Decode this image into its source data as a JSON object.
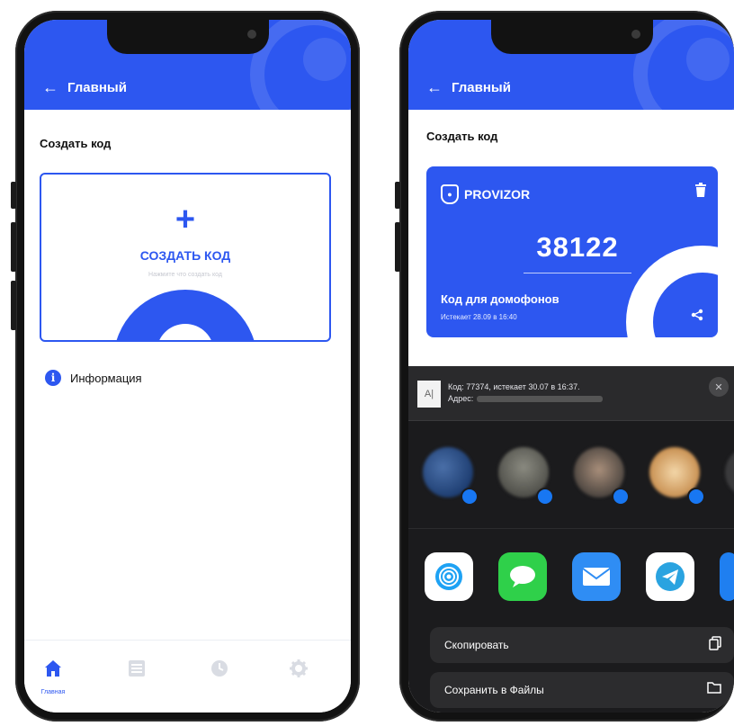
{
  "left": {
    "header": {
      "back_icon": "arrow-left-icon",
      "title": "Главный"
    },
    "section_title": "Создать код",
    "create_card": {
      "plus": "+",
      "label": "СОЗДАТЬ КОД",
      "hint": "Нажмите что создать код"
    },
    "info": {
      "icon": "i",
      "label": "Информация"
    },
    "tabbar": [
      {
        "icon": "home-icon",
        "label": "Главная",
        "active": true
      },
      {
        "icon": "list-icon",
        "label": "",
        "active": false
      },
      {
        "icon": "clock-icon",
        "label": "",
        "active": false
      },
      {
        "icon": "gear-icon",
        "label": "",
        "active": false
      }
    ]
  },
  "right": {
    "header": {
      "back_icon": "arrow-left-icon",
      "title": "Главный"
    },
    "section_title": "Создать код",
    "code_card": {
      "brand": "PROVIZOR",
      "code": "38122",
      "title": "Код для домофонов",
      "expires": "Истекает 28.09 в 16:40"
    },
    "share_sheet": {
      "thumb": "A|",
      "preview_line1": "Код: 77374, истекает 30.07 в 16:37.",
      "preview_line2": "Адрес:",
      "close": "✕",
      "actions": [
        {
          "label": "Скопировать",
          "icon": "copy-icon"
        },
        {
          "label": "Сохранить в Файлы",
          "icon": "folder-icon"
        }
      ]
    }
  },
  "colors": {
    "accent": "#2d57f0",
    "sheet_bg": "#1b1b1d"
  }
}
